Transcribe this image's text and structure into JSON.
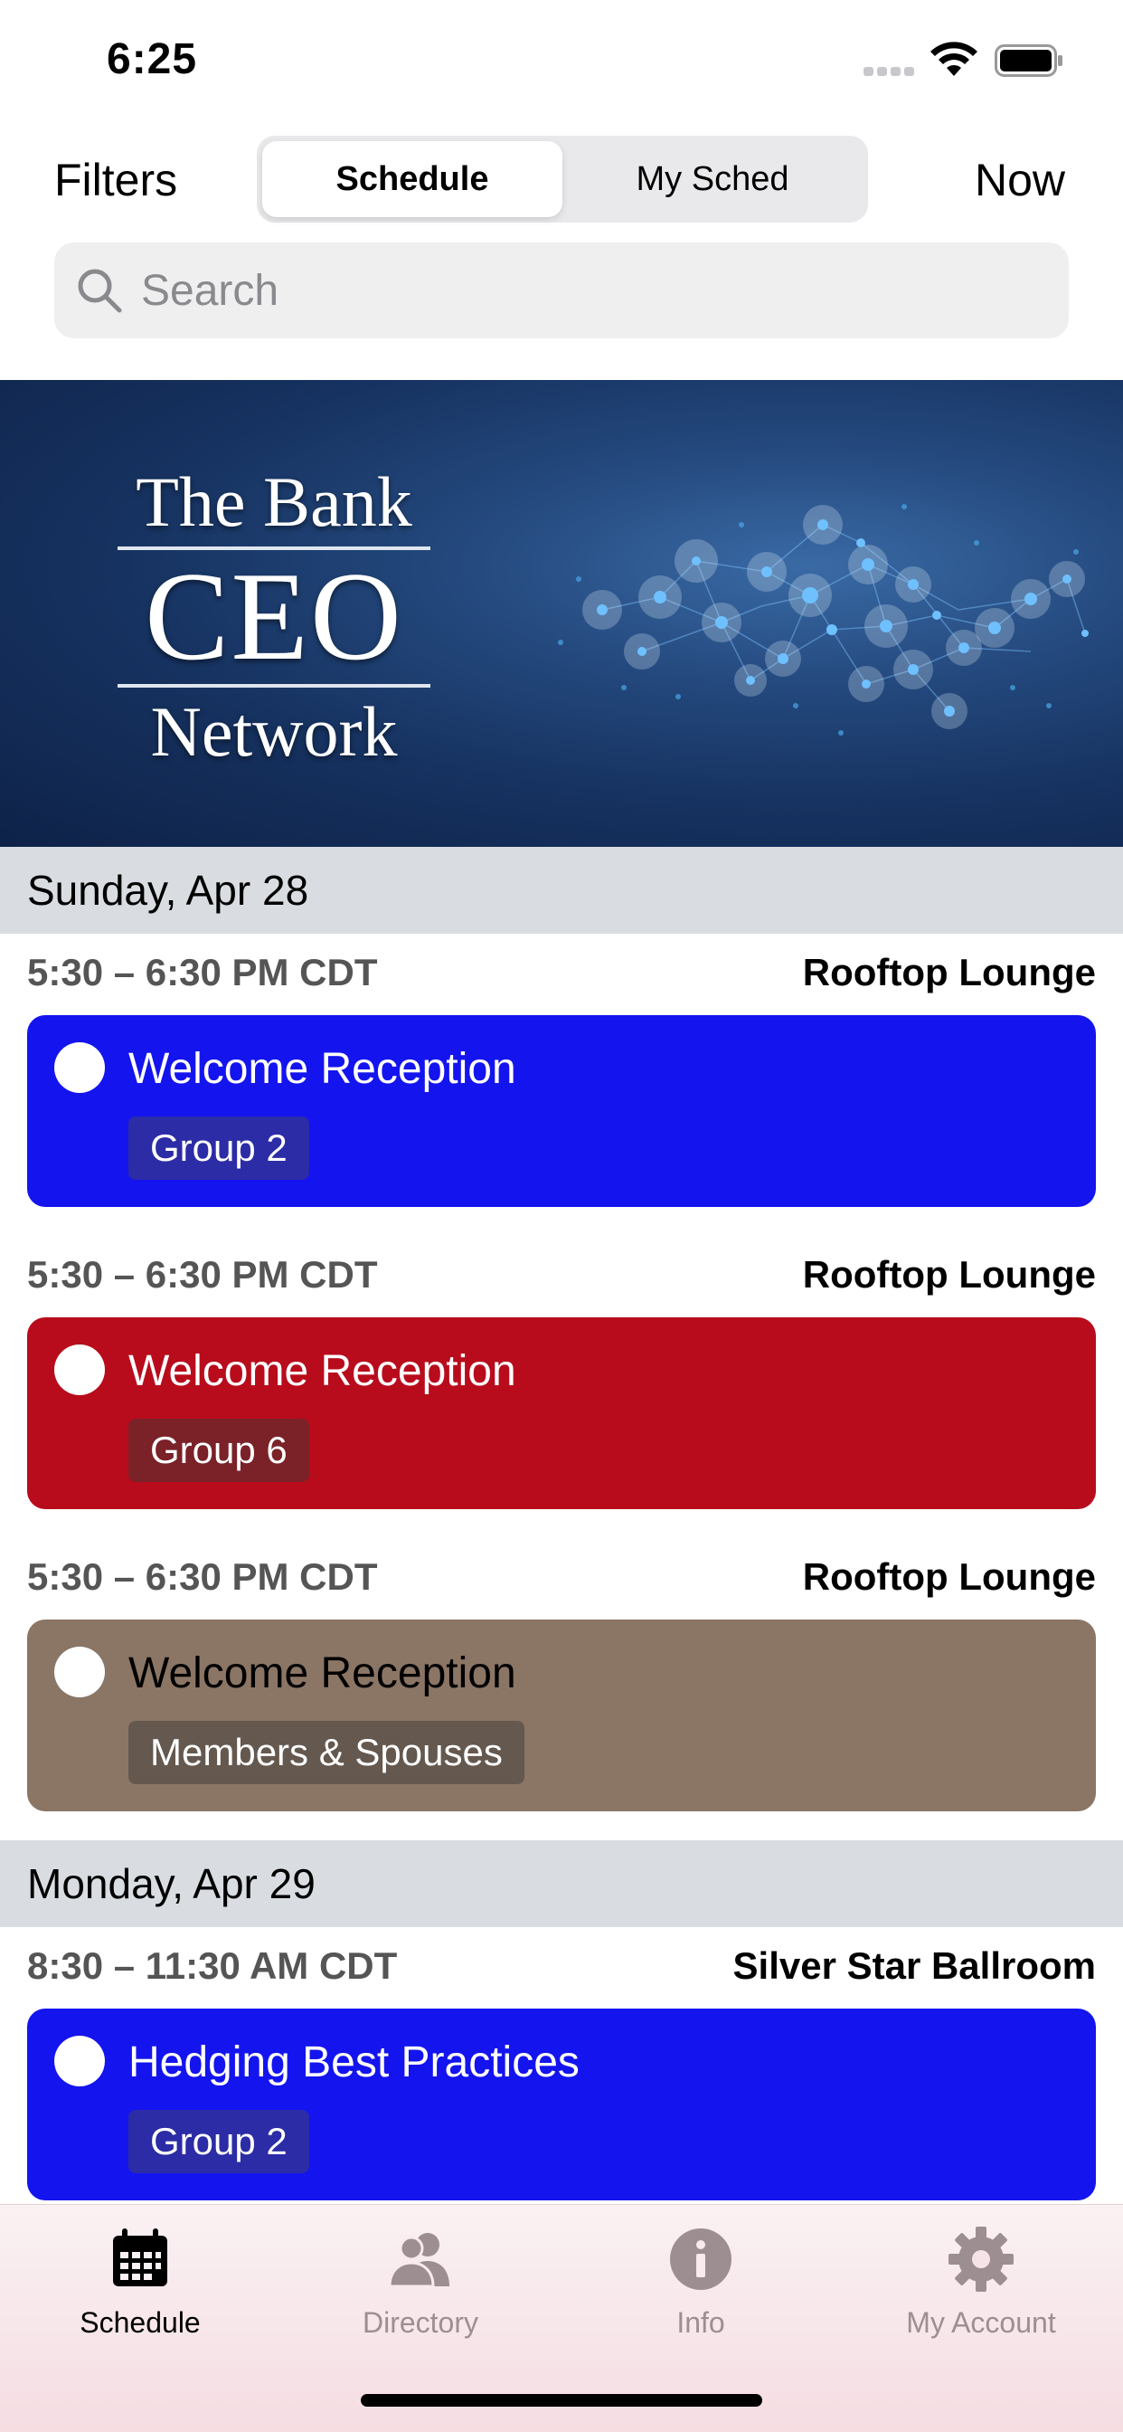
{
  "status_bar": {
    "time": "6:25"
  },
  "header": {
    "filters_label": "Filters",
    "now_label": "Now",
    "segments": [
      {
        "label": "Schedule",
        "active": true
      },
      {
        "label": "My Sched",
        "active": false
      }
    ],
    "search_placeholder": "Search"
  },
  "banner": {
    "logo_lines": [
      "The Bank",
      "CEO",
      "Network"
    ]
  },
  "schedule": {
    "days": [
      {
        "label": "Sunday, Apr 28",
        "events": [
          {
            "time": "5:30 – 6:30 PM CDT",
            "room": "Rooftop Lounge",
            "title": "Welcome Reception",
            "tag": "Group 2",
            "color": "#1414ef",
            "tag_color": "#2c2ca6",
            "title_color": "#ffffff"
          },
          {
            "time": "5:30 – 6:30 PM CDT",
            "room": "Rooftop Lounge",
            "title": "Welcome Reception",
            "tag": "Group 6",
            "color": "#b80c1c",
            "tag_color": "#7a2228",
            "title_color": "#ffffff"
          },
          {
            "time": "5:30 – 6:30 PM CDT",
            "room": "Rooftop Lounge",
            "title": "Welcome Reception",
            "tag": "Members & Spouses",
            "color": "#8b7565",
            "tag_color": "#64584f",
            "title_color": "#000000"
          }
        ]
      },
      {
        "label": "Monday, Apr 29",
        "events": [
          {
            "time": "8:30 – 11:30 AM CDT",
            "room": "Silver Star Ballroom",
            "title": "Hedging Best Practices",
            "tag": "Group 2",
            "color": "#1414ef",
            "tag_color": "#2c2ca6",
            "title_color": "#ffffff"
          }
        ]
      }
    ]
  },
  "tabbar": {
    "tabs": [
      {
        "label": "Schedule",
        "icon": "calendar-icon",
        "active": true
      },
      {
        "label": "Directory",
        "icon": "people-icon",
        "active": false
      },
      {
        "label": "Info",
        "icon": "info-icon",
        "active": false
      },
      {
        "label": "My Account",
        "icon": "gear-icon",
        "active": false
      }
    ]
  }
}
